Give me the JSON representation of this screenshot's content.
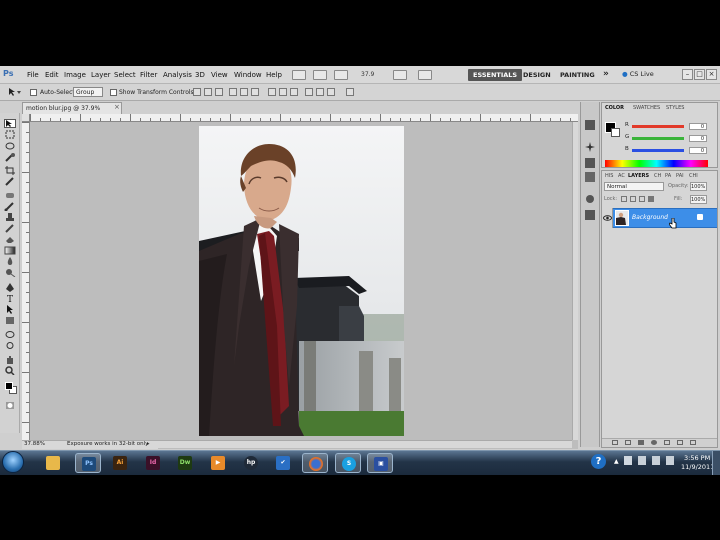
{
  "app": {
    "logo": "Ps",
    "menus": [
      "File",
      "Edit",
      "Image",
      "Layer",
      "Select",
      "Filter",
      "Analysis",
      "3D",
      "View",
      "Window",
      "Help"
    ],
    "zoom_value": "37.9",
    "workspaces": {
      "active": "ESSENTIALS",
      "design": "DESIGN",
      "painting": "PAINTING",
      "more": "»"
    },
    "cs_live": "CS Live"
  },
  "options_bar": {
    "auto_select_label": "Auto-Select:",
    "auto_select_value": "Group",
    "show_transform_label": "Show Transform Controls"
  },
  "document": {
    "tab_title": "motion blur.jpg @ 37.9% (RGB/8)",
    "close": "×",
    "status_zoom": "37.88%",
    "status_info": "Exposure works in 32-bit only"
  },
  "color_panel": {
    "tabs": [
      "COLOR",
      "SWATCHES",
      "STYLES"
    ],
    "sliders": [
      {
        "label": "R",
        "value": "0",
        "color": "#e23a2a"
      },
      {
        "label": "G",
        "value": "0",
        "color": "#3ab43a"
      },
      {
        "label": "B",
        "value": "0",
        "color": "#2a4fe2"
      }
    ]
  },
  "layers_panel": {
    "tabs": [
      "HIS",
      "AC",
      "LAYERS",
      "CH",
      "PA",
      "PAI",
      "CHI"
    ],
    "blend_mode": "Normal",
    "opacity_label": "Opacity:",
    "opacity_value": "100%",
    "lock_label": "Lock:",
    "fill_label": "Fill:",
    "fill_value": "100%",
    "layer_name": "Background"
  },
  "taskbar": {
    "apps": [
      {
        "name": "explorer",
        "glyph": "",
        "color": "#e8b84a"
      },
      {
        "name": "photoshop",
        "glyph": "Ps",
        "color": "#1d4a7a"
      },
      {
        "name": "illustrator",
        "glyph": "Ai",
        "color": "#e07b18"
      },
      {
        "name": "indesign",
        "glyph": "Id",
        "color": "#c8267a"
      },
      {
        "name": "dreamweaver",
        "glyph": "Dw",
        "color": "#3a8a2a"
      },
      {
        "name": "media-player",
        "glyph": "▶",
        "color": "#e88a2a"
      },
      {
        "name": "hp",
        "glyph": "hp",
        "color": "#1f2a38"
      },
      {
        "name": "task-app",
        "glyph": "✔",
        "color": "#2a6fc4"
      },
      {
        "name": "firefox",
        "glyph": "",
        "color": "#e0702a"
      },
      {
        "name": "skype",
        "glyph": "S",
        "color": "#1aa0e0"
      },
      {
        "name": "screen-app",
        "glyph": "▣",
        "color": "#2a4fa0"
      }
    ],
    "help": "?",
    "time": "3:56 PM",
    "date": "11/9/2011"
  }
}
